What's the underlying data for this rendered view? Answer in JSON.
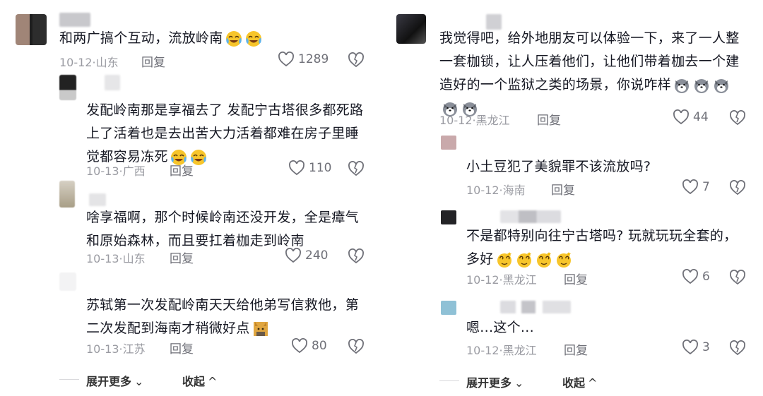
{
  "comments_left": [
    {
      "text": "和两广搞个互动，流放岭南",
      "emoji": [
        "laugh-cry",
        "laugh-cry"
      ],
      "date_location": "10-12·山东",
      "reply_label": "回复",
      "likes": "1289"
    },
    {
      "text": "发配岭南那是享福去了 发配宁古塔很多都死路上了活着也是去出苦大力活着都难在房子里睡觉都容易冻死",
      "emoji": [
        "laugh-cry",
        "laugh-cry"
      ],
      "date_location": "10-13·广西",
      "reply_label": "回复",
      "likes": "110"
    },
    {
      "text": "啥享福啊，那个时候岭南还没开发，全是瘴气和原始森林，而且要扛着枷走到岭南",
      "date_location": "10-13·山东",
      "reply_label": "回复",
      "likes": "240"
    },
    {
      "text": "苏轼第一次发配岭南天天给他弟写信救他，第二次发配到海南才稍微好点",
      "emoji": [
        "cat"
      ],
      "date_location": "10-13·江苏",
      "reply_label": "回复",
      "likes": "80"
    }
  ],
  "comments_right": [
    {
      "text": "我觉得吧，给外地朋友可以体验一下，来了一人整一套枷锁，让人压着他们，让他们带着枷去一个建造好的一个监狱之类的场景，你说咋样",
      "emoji": [
        "husky",
        "husky",
        "husky",
        "husky",
        "husky"
      ],
      "date_location": "10-12·黑龙江",
      "reply_label": "回复",
      "likes": "44"
    },
    {
      "text": "小土豆犯了美貌罪不该流放吗?",
      "date_location": "10-12·海南",
      "reply_label": "回复",
      "likes": "7"
    },
    {
      "text": "不是都特别向往宁古塔吗? 玩就玩玩全套的，多好",
      "emoji": [
        "dizzy",
        "dizzy",
        "dizzy",
        "dizzy"
      ],
      "date_location": "10-12·黑龙江",
      "reply_label": "回复",
      "likes": "6"
    },
    {
      "text": "嗯...这个...",
      "date_location": "10-12·黑龙江",
      "reply_label": "回复",
      "likes": "3"
    }
  ],
  "footer": {
    "expand_more": "展开更多",
    "collapse": "收起"
  },
  "colors": {
    "text": "#161823",
    "meta": "#9a9ba2",
    "emoji_yellow": "#f7c52b"
  }
}
